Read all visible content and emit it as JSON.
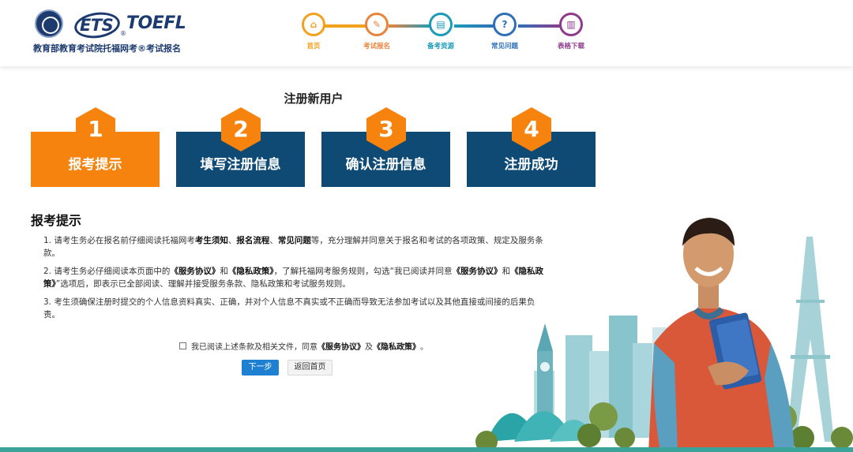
{
  "header": {
    "ets_text": "ETS",
    "toefl_text": "TOEFL",
    "reg_mark": "®",
    "brand_subtitle": "教育部教育考试院托福网考®考试报名"
  },
  "nav": [
    {
      "label": "首页",
      "glyph": "⌂",
      "color": "#f2a11f",
      "icon": "home-icon"
    },
    {
      "label": "考试报名",
      "glyph": "✎",
      "color": "#e8843c",
      "icon": "pencil-icon"
    },
    {
      "label": "备考资源",
      "glyph": "▤",
      "color": "#1b9bb8",
      "icon": "book-icon"
    },
    {
      "label": "常见问题",
      "glyph": "?",
      "color": "#2f6fb7",
      "icon": "question-icon"
    },
    {
      "label": "表格下载",
      "glyph": "▥",
      "color": "#8e3b8c",
      "icon": "download-icon"
    }
  ],
  "page_title": "注册新用户",
  "steps": [
    {
      "num": "1",
      "label": "报考提示",
      "active": true
    },
    {
      "num": "2",
      "label": "填写注册信息",
      "active": false
    },
    {
      "num": "3",
      "label": "确认注册信息",
      "active": false
    },
    {
      "num": "4",
      "label": "注册成功",
      "active": false
    }
  ],
  "colors": {
    "step_active": "#f7830f",
    "step_inactive": "#0f4a74",
    "step_hex": "#f7830f",
    "primary_button": "#1f7fd0",
    "footer_bar": "#3aa39a"
  },
  "section_title": "报考提示",
  "rules": {
    "r1": {
      "a": "1. 请考生务必在报名前仔细阅读托福网考",
      "b1": "考生须知",
      "s1": "、",
      "b2": "报名流程",
      "s2": "、",
      "b3": "常见问题",
      "c": "等，充分理解并同意关于报名和考试的各项政策、规定及服务条款。"
    },
    "r2": {
      "a": "2. 请考生务必仔细阅读本页面中的",
      "b1": "《服务协议》",
      "s1": "和",
      "b2": "《隐私政策》",
      "s2": "，了解托福网考服务规则，勾选“我已阅读并同意",
      "b3": "《服务协议》",
      "s3": "和",
      "b4": "《隐私政策》",
      "c": "”选项后，即表示已全部阅读、理解并接受服务条款、隐私政策和考试服务规则。"
    },
    "r3": {
      "a": "3. 考生须确保注册时提交的个人信息资料真实、正确，并对个人信息不真实或不正确而导致无法参加考试以及其他直接或间接的后果负责。"
    }
  },
  "agree": {
    "a": "我已阅读上述条款及相关文件，同意",
    "b1": "《服务协议》",
    "s": "及",
    "b2": "《隐私政策》",
    "c": "。"
  },
  "buttons": {
    "next": "下一步",
    "home": "返回首页"
  }
}
